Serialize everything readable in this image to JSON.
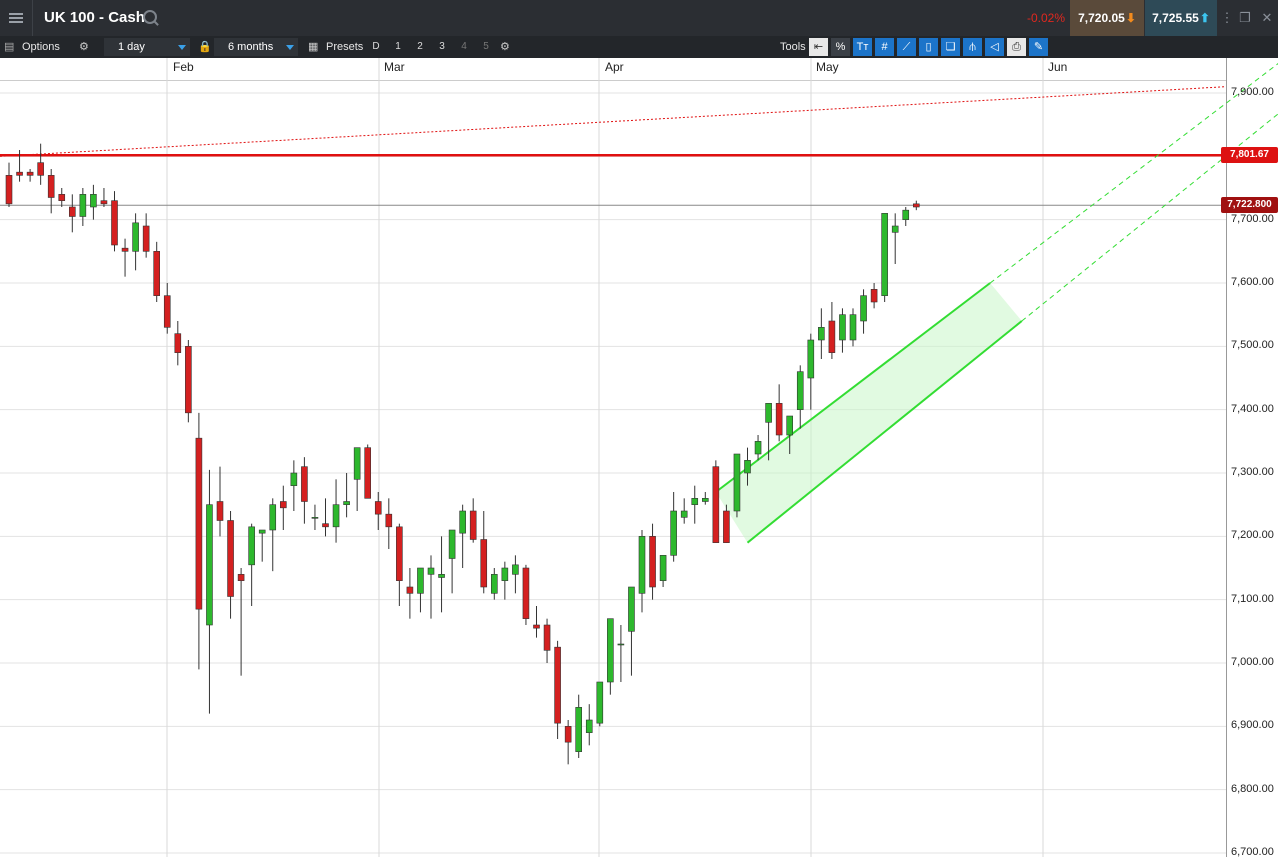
{
  "header": {
    "menu_icon": "hamburger-icon",
    "title": "UK 100 - Cash",
    "search_icon": "search-icon",
    "change": "-0.02%",
    "sell_price": "7,720.05",
    "buy_price": "7,725.55"
  },
  "toolbar": {
    "options_label": "Options",
    "interval": "1 day",
    "range": "6 months",
    "presets_label": "Presets",
    "preset_buttons": [
      "D",
      "1",
      "2",
      "3",
      "4",
      "5"
    ],
    "tools_label": "Tools",
    "tool_percent": "%",
    "tool_text": "Tт"
  },
  "colors": {
    "up": "#2db82d",
    "down": "#d42020",
    "resistance": "#e01010",
    "channel": "#33dd33",
    "channel_fill": "#c9f5c9"
  },
  "chart_data": {
    "type": "candlestick",
    "x_axis_labels": [
      "Feb",
      "Mar",
      "Apr",
      "May",
      "Jun"
    ],
    "y_ticks": [
      "7,900.00",
      "7,800.00",
      "7,700.00",
      "7,600.00",
      "7,500.00",
      "7,400.00",
      "7,300.00",
      "7,200.00",
      "7,100.00",
      "7,000.00",
      "6,900.00",
      "6,800.00",
      "6,700.00"
    ],
    "ylim": [
      6700,
      7910
    ],
    "resistance_level": 7801.67,
    "resistance_label": "7,801.67",
    "current_price": 7722.8,
    "current_price_label": "7,722.800",
    "candles": [
      [
        7770,
        7790,
        7720,
        7725
      ],
      [
        7775,
        7810,
        7760,
        7770
      ],
      [
        7775,
        7780,
        7760,
        7770
      ],
      [
        7790,
        7820,
        7755,
        7770
      ],
      [
        7770,
        7780,
        7710,
        7735
      ],
      [
        7740,
        7750,
        7720,
        7730
      ],
      [
        7720,
        7740,
        7680,
        7705
      ],
      [
        7705,
        7750,
        7690,
        7740
      ],
      [
        7720,
        7755,
        7700,
        7740
      ],
      [
        7730,
        7750,
        7720,
        7725
      ],
      [
        7730,
        7745,
        7650,
        7660
      ],
      [
        7655,
        7670,
        7610,
        7650
      ],
      [
        7650,
        7710,
        7620,
        7695
      ],
      [
        7690,
        7710,
        7640,
        7650
      ],
      [
        7650,
        7665,
        7570,
        7580
      ],
      [
        7580,
        7600,
        7520,
        7530
      ],
      [
        7520,
        7540,
        7470,
        7490
      ],
      [
        7500,
        7510,
        7380,
        7395
      ],
      [
        7355,
        7395,
        6990,
        7085
      ],
      [
        7060,
        7305,
        6920,
        7250
      ],
      [
        7255,
        7310,
        7200,
        7225
      ],
      [
        7225,
        7240,
        7070,
        7105
      ],
      [
        7140,
        7150,
        6980,
        7130
      ],
      [
        7155,
        7220,
        7090,
        7215
      ],
      [
        7205,
        7210,
        7160,
        7210
      ],
      [
        7210,
        7260,
        7145,
        7250
      ],
      [
        7255,
        7280,
        7210,
        7245
      ],
      [
        7280,
        7320,
        7240,
        7300
      ],
      [
        7310,
        7325,
        7220,
        7255
      ],
      [
        7230,
        7250,
        7210,
        7230
      ],
      [
        7220,
        7260,
        7200,
        7215
      ],
      [
        7215,
        7290,
        7190,
        7250
      ],
      [
        7250,
        7300,
        7230,
        7255
      ],
      [
        7290,
        7340,
        7240,
        7340
      ],
      [
        7340,
        7345,
        7270,
        7260
      ],
      [
        7255,
        7270,
        7210,
        7235
      ],
      [
        7235,
        7260,
        7180,
        7215
      ],
      [
        7215,
        7220,
        7090,
        7130
      ],
      [
        7120,
        7150,
        7070,
        7110
      ],
      [
        7110,
        7150,
        7080,
        7150
      ],
      [
        7140,
        7170,
        7070,
        7150
      ],
      [
        7135,
        7200,
        7080,
        7140
      ],
      [
        7165,
        7210,
        7110,
        7210
      ],
      [
        7205,
        7250,
        7150,
        7240
      ],
      [
        7240,
        7260,
        7190,
        7195
      ],
      [
        7195,
        7240,
        7110,
        7120
      ],
      [
        7110,
        7150,
        7100,
        7140
      ],
      [
        7130,
        7160,
        7100,
        7150
      ],
      [
        7140,
        7170,
        7110,
        7155
      ],
      [
        7150,
        7155,
        7060,
        7070
      ],
      [
        7060,
        7090,
        7040,
        7055
      ],
      [
        7060,
        7070,
        7000,
        7020
      ],
      [
        7025,
        7035,
        6880,
        6905
      ],
      [
        6900,
        6910,
        6840,
        6875
      ],
      [
        6860,
        6950,
        6850,
        6930
      ],
      [
        6890,
        6935,
        6870,
        6910
      ],
      [
        6905,
        6970,
        6900,
        6970
      ],
      [
        6970,
        7070,
        6950,
        7070
      ],
      [
        7030,
        7060,
        6970,
        7030
      ],
      [
        7050,
        7110,
        6980,
        7120
      ],
      [
        7110,
        7210,
        7080,
        7200
      ],
      [
        7200,
        7220,
        7100,
        7120
      ],
      [
        7130,
        7170,
        7120,
        7170
      ],
      [
        7170,
        7270,
        7160,
        7240
      ],
      [
        7230,
        7260,
        7220,
        7240
      ],
      [
        7250,
        7280,
        7220,
        7260
      ],
      [
        7255,
        7270,
        7250,
        7260
      ],
      [
        7310,
        7320,
        7190,
        7190
      ],
      [
        7240,
        7250,
        7190,
        7190
      ],
      [
        7240,
        7330,
        7230,
        7330
      ],
      [
        7300,
        7340,
        7280,
        7320
      ],
      [
        7330,
        7360,
        7320,
        7350
      ],
      [
        7380,
        7410,
        7320,
        7410
      ],
      [
        7410,
        7440,
        7350,
        7360
      ],
      [
        7360,
        7390,
        7330,
        7390
      ],
      [
        7400,
        7470,
        7370,
        7460
      ],
      [
        7450,
        7520,
        7400,
        7510
      ],
      [
        7510,
        7560,
        7480,
        7530
      ],
      [
        7540,
        7570,
        7480,
        7490
      ],
      [
        7510,
        7560,
        7490,
        7550
      ],
      [
        7510,
        7560,
        7500,
        7550
      ],
      [
        7540,
        7590,
        7520,
        7580
      ],
      [
        7590,
        7600,
        7560,
        7570
      ],
      [
        7580,
        7620,
        7570,
        7710
      ],
      [
        7680,
        7710,
        7630,
        7690
      ],
      [
        7700,
        7720,
        7690,
        7715
      ],
      [
        7725,
        7730,
        7715,
        7720
      ]
    ],
    "channel": {
      "upper_start": [
        67,
        7270
      ],
      "upper_end": [
        93,
        7600
      ],
      "lower_start": [
        70,
        7190
      ],
      "lower_end": [
        96,
        7540
      ],
      "upper_ext_end": [
        103,
        7880
      ],
      "lower_ext_end": [
        108,
        7880
      ]
    },
    "trendline": {
      "start": [
        0,
        7800
      ],
      "end": [
        120,
        7900
      ]
    }
  }
}
